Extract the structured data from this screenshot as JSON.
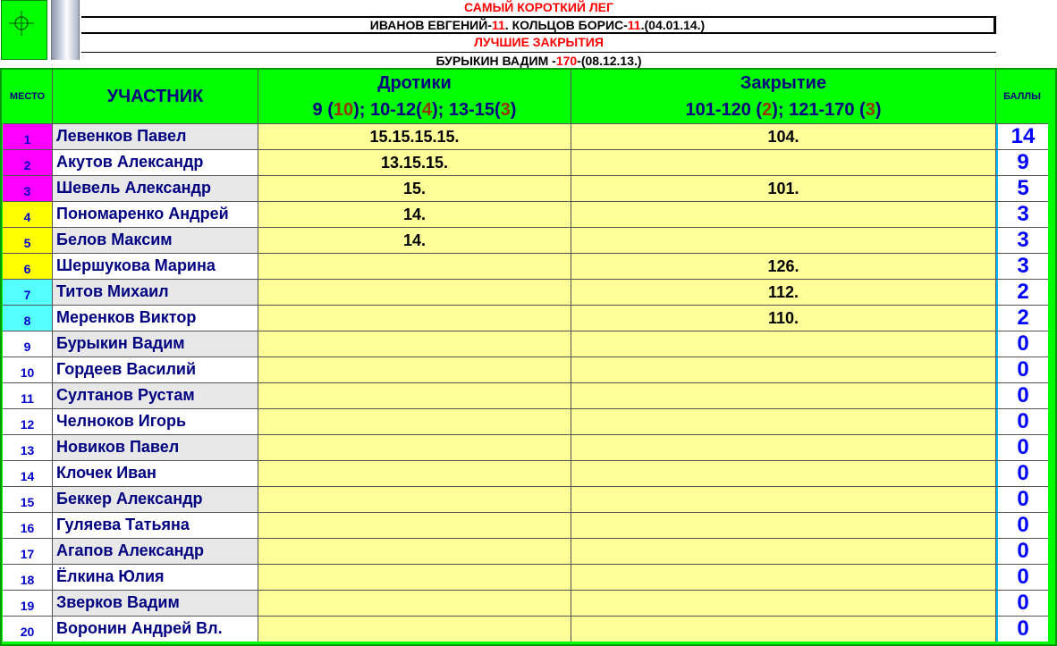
{
  "records": {
    "short_leg_title": "САМЫЙ КОРОТКИЙ ЛЕГ",
    "short_leg_line": [
      "ИВАНОВ ЕВГЕНИЙ-",
      "11",
      ". КОЛЬЦОВ БОРИС-",
      "11",
      ".(04.01.14.)"
    ],
    "best_close_title": "ЛУЧШИЕ ЗАКРЫТИЯ",
    "best_close_line": [
      "БУРЫКИН ВАДИМ -",
      "170",
      "-(08.12.13.)"
    ]
  },
  "columns": {
    "place": "МЕСТО",
    "participant": "УЧАСТНИК",
    "darts_title": "Дротики",
    "darts_sub": [
      "9 (",
      "10",
      "); 10-12(",
      "4",
      "); 13-15(",
      "3",
      ")"
    ],
    "close_title": "Закрытие",
    "close_sub": [
      "101-120 (",
      "2",
      "); 121-170 (",
      "3",
      ")"
    ],
    "points": "БАЛЛЫ"
  },
  "colors": {
    "place_top3": "#ff00ff",
    "place_4_6": "#ffff00",
    "place_7_8": "#55ffff",
    "place_rest": "#ffffff",
    "background": "#00ff00"
  },
  "rows": [
    {
      "place": "1",
      "name": "Левенков Павел",
      "darts": "15.15.15.15.",
      "close": "104.",
      "points": "14",
      "tier": "top3"
    },
    {
      "place": "2",
      "name": "Акутов Александр",
      "darts": "13.15.15.",
      "close": "",
      "points": "9",
      "tier": "top3"
    },
    {
      "place": "3",
      "name": "Шевель Александр",
      "darts": "15.",
      "close": "101.",
      "points": "5",
      "tier": "top3"
    },
    {
      "place": "4",
      "name": "Пономаренко Андрей",
      "darts": "14.",
      "close": "",
      "points": "3",
      "tier": "mid"
    },
    {
      "place": "5",
      "name": "Белов Максим",
      "darts": "14.",
      "close": "",
      "points": "3",
      "tier": "mid"
    },
    {
      "place": "6",
      "name": "Шершукова Марина",
      "darts": "",
      "close": "126.",
      "points": "3",
      "tier": "mid"
    },
    {
      "place": "7",
      "name": "Титов Михаил",
      "darts": "",
      "close": "112.",
      "points": "2",
      "tier": "low"
    },
    {
      "place": "8",
      "name": "Меренков Виктор",
      "darts": "",
      "close": "110.",
      "points": "2",
      "tier": "low"
    },
    {
      "place": "9",
      "name": "Бурыкин Вадим",
      "darts": "",
      "close": "",
      "points": "0",
      "tier": "rest"
    },
    {
      "place": "10",
      "name": "Гордеев Василий",
      "darts": "",
      "close": "",
      "points": "0",
      "tier": "rest"
    },
    {
      "place": "11",
      "name": "Султанов Рустам",
      "darts": "",
      "close": "",
      "points": "0",
      "tier": "rest"
    },
    {
      "place": "12",
      "name": "Челноков Игорь",
      "darts": "",
      "close": "",
      "points": "0",
      "tier": "rest"
    },
    {
      "place": "13",
      "name": "Новиков Павел",
      "darts": "",
      "close": "",
      "points": "0",
      "tier": "rest"
    },
    {
      "place": "14",
      "name": "Клочек Иван",
      "darts": "",
      "close": "",
      "points": "0",
      "tier": "rest"
    },
    {
      "place": "15",
      "name": "Беккер Александр",
      "darts": "",
      "close": "",
      "points": "0",
      "tier": "rest"
    },
    {
      "place": "16",
      "name": "Гуляева Татьяна",
      "darts": "",
      "close": "",
      "points": "0",
      "tier": "rest"
    },
    {
      "place": "17",
      "name": "Агапов Александр",
      "darts": "",
      "close": "",
      "points": "0",
      "tier": "rest"
    },
    {
      "place": "18",
      "name": "Ёлкина Юлия",
      "darts": "",
      "close": "",
      "points": "0",
      "tier": "rest"
    },
    {
      "place": "19",
      "name": "Зверков Вадим",
      "darts": "",
      "close": "",
      "points": "0",
      "tier": "rest"
    },
    {
      "place": "20",
      "name": "Воронин Андрей Вл.",
      "darts": "",
      "close": "",
      "points": "0",
      "tier": "rest"
    }
  ]
}
